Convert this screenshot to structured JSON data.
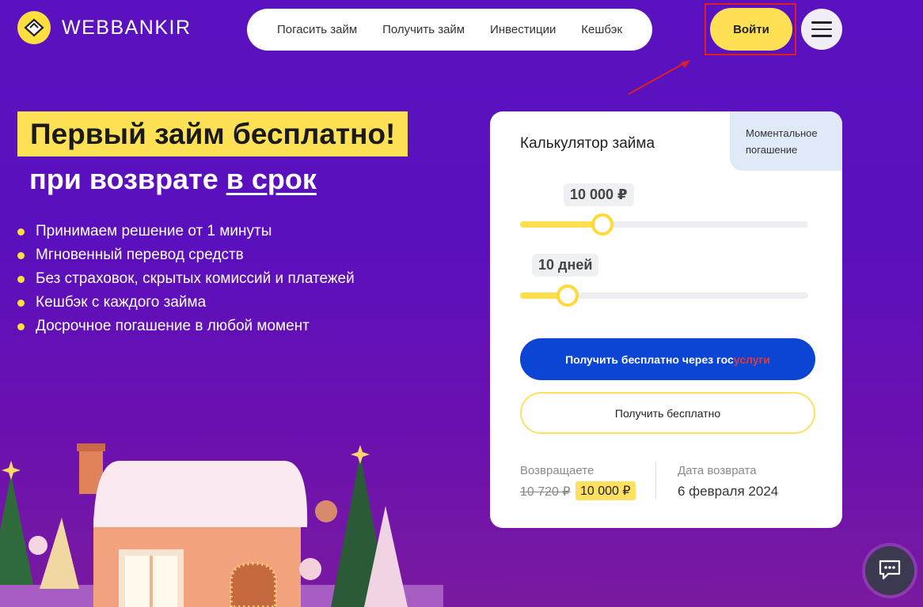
{
  "brand": {
    "name": "WEBBANKIR"
  },
  "nav": {
    "items": [
      "Погасить займ",
      "Получить займ",
      "Инвестиции",
      "Кешбэк"
    ]
  },
  "header": {
    "login_label": "Войти"
  },
  "hero": {
    "headline": "Первый займ бесплатно!",
    "subhead_prefix": "при возврате ",
    "subhead_link": "в срок",
    "features": [
      "Принимаем решение от 1 минуты",
      "Мгновенный перевод средств",
      "Без страховок, скрытых комиссий и платежей",
      "Кешбэк с каждого займа",
      "Досрочное погашение в любой момент"
    ]
  },
  "calculator": {
    "title": "Калькулятор займа",
    "tag_line1": "Моментальное",
    "tag_line2": "погашение",
    "amount_value": "10 000 ₽",
    "amount_fraction": 0.28,
    "days_value": "10 дней",
    "days_fraction": 0.16,
    "gos_button_prefix": "Получить бесплатно через гос",
    "gos_button_suffix": "услуги",
    "free_button": "Получить бесплатно",
    "return_label": "Возвращаете",
    "return_old": "10 720 ₽",
    "return_new": "10 000 ₽",
    "date_label": "Дата возврата",
    "date_value": "6 февраля 2024"
  },
  "colors": {
    "accent_yellow": "#ffdf3f",
    "gos_blue": "#0a45d3",
    "background_purple": "#5a12c0"
  }
}
